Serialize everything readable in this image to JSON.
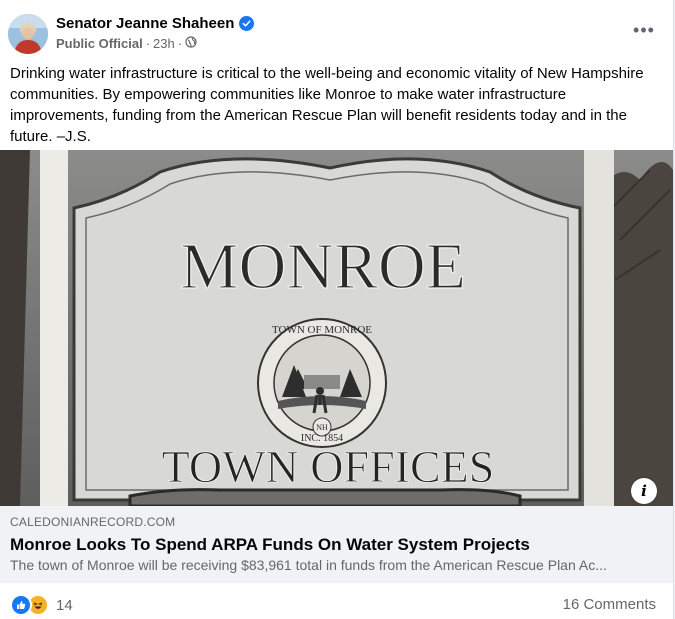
{
  "post": {
    "author": "Senator Jeanne Shaheen",
    "badge": "Public Official",
    "time": "23h",
    "separator": "·",
    "more_icon": "•••",
    "body": "Drinking water infrastructure is critical to the well-being and economic vitality of New Hampshire communities. By empowering communities like Monroe to make water infrastructure improvements, funding from the American Rescue Plan will benefit residents today and in the future. –J.S."
  },
  "photo": {
    "sign_title": "MONROE",
    "sign_subtitle": "TOWN OFFICES",
    "seal_top": "TOWN OF MONROE",
    "seal_bottom": "INC. 1854",
    "seal_state": "NH",
    "info_label": "i"
  },
  "link": {
    "domain": "CALEDONIANRECORD.COM",
    "headline": "Monroe Looks To Spend ARPA Funds On Water System Projects",
    "description": "The town of Monroe will be receiving $83,961 total in funds from the American Rescue Plan Ac..."
  },
  "footer": {
    "reaction_count": "14",
    "comments": "16 Comments",
    "reaction_icons": [
      "like-icon",
      "haha-icon"
    ]
  },
  "colors": {
    "accent": "#1877f2",
    "secondary_text": "#65676b",
    "link_bg": "#f0f2f5"
  }
}
